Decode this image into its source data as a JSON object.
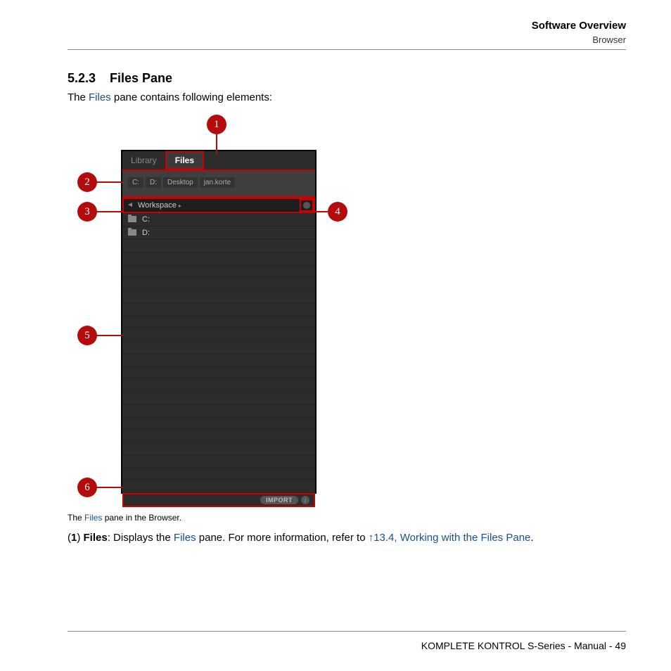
{
  "header": {
    "title": "Software Overview",
    "sub": "Browser"
  },
  "section": {
    "num": "5.2.3",
    "title": "Files Pane"
  },
  "intro": {
    "pre": "The ",
    "link": "Files",
    "post": " pane contains following elements:"
  },
  "callouts": {
    "c1": "1",
    "c2": "2",
    "c3": "3",
    "c4": "4",
    "c5": "5",
    "c6": "6"
  },
  "app": {
    "tab_library": "Library",
    "tab_files": "Files",
    "fav1": "C:",
    "fav2": "D:",
    "fav3": "Desktop",
    "fav4": "jan.korte",
    "path": "Workspace",
    "drive1": "C:",
    "drive2": "D:",
    "import": "IMPORT",
    "info": "i"
  },
  "caption": {
    "pre": "The ",
    "link": "Files",
    "post": " pane in the Browser."
  },
  "desc": {
    "p1a": "(",
    "p1b": "1",
    "p1c": ") ",
    "p1d": "Files",
    "p1e": ": Displays the ",
    "p1f": "Files",
    "p1g": " pane. For more information, refer to ",
    "p1h": "↑13.4, Working with the Files Pane",
    "p1i": "."
  },
  "footer": {
    "text": "KOMPLETE KONTROL S-Series - Manual - 49"
  }
}
